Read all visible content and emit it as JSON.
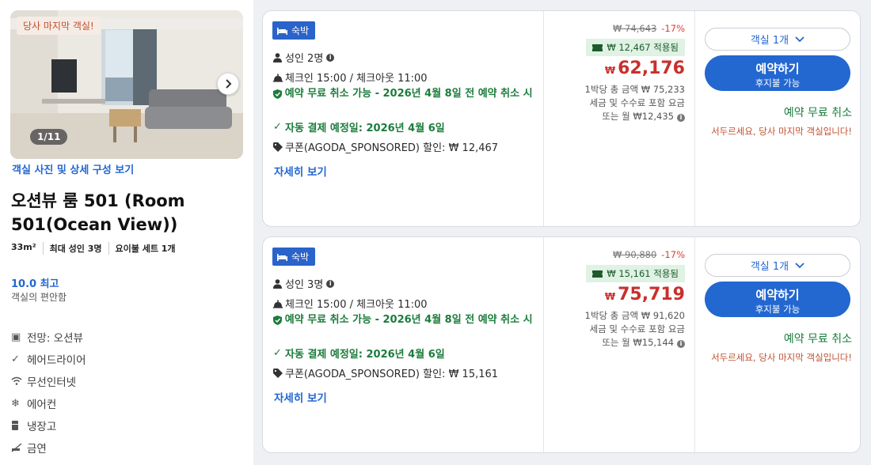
{
  "room": {
    "last_room_badge": "당사 마지막 객실!",
    "photo_counter": "1/11",
    "photo_link": "객실 사진 및 상세 구성 보기",
    "title": "오션뷰 룸 501 (Room 501(Ocean View))",
    "specs": [
      "33m²",
      "최대 성인 3명",
      "요이불 세트 1개"
    ],
    "rating": "10.0 최고",
    "rating_sub": "객실의 편안함",
    "amenities": [
      {
        "icon": "view-icon",
        "label": "전망: 오션뷰"
      },
      {
        "icon": "check-icon",
        "label": "헤어드라이어"
      },
      {
        "icon": "wifi-icon",
        "label": "무선인터넷"
      },
      {
        "icon": "snowflake-icon",
        "label": "에어컨"
      },
      {
        "icon": "fridge-icon",
        "label": "냉장고"
      },
      {
        "icon": "no-smoking-icon",
        "label": "금연"
      }
    ]
  },
  "offers": [
    {
      "tag": "숙박",
      "guests": "성인 2명",
      "checkin": "체크인 15:00 / 체크아웃 11:00",
      "cancel": "예약 무료 취소 가능 - 2026년 4월 8일 전 예약 취소 시",
      "autopay": "자동 결제 예정일: 2026년 4월 6일",
      "coupon": "쿠폰(AGODA_SPONSORED) 할인: ₩ 12,467",
      "details": "자세히 보기",
      "original_price": "₩ 74,643",
      "discount": "-17%",
      "coupon_applied": "₩ 12,467 적용됨",
      "currency": "₩",
      "price": "62,176",
      "per_night": "1박당 총 금액 ₩ 75,233",
      "tax_note": "세금 및 수수료 포함 요금",
      "monthly": "또는 월 ₩12,435",
      "room_select": "객실 1개",
      "book": "예약하기",
      "pay_later": "후지불 가능",
      "free_cancel": "예약 무료 취소",
      "last_room": "서두르세요, 당사 마지막 객실입니다!"
    },
    {
      "tag": "숙박",
      "guests": "성인 3명",
      "checkin": "체크인 15:00 / 체크아웃 11:00",
      "cancel": "예약 무료 취소 가능 - 2026년 4월 8일 전 예약 취소 시",
      "autopay": "자동 결제 예정일: 2026년 4월 6일",
      "coupon": "쿠폰(AGODA_SPONSORED) 할인: ₩ 15,161",
      "details": "자세히 보기",
      "original_price": "₩ 90,880",
      "discount": "-17%",
      "coupon_applied": "₩ 15,161 적용됨",
      "currency": "₩",
      "price": "75,719",
      "per_night": "1박당 총 금액 ₩ 91,620",
      "tax_note": "세금 및 수수료 포함 요금",
      "monthly": "또는 월 ₩15,144",
      "room_select": "객실 1개",
      "book": "예약하기",
      "pay_later": "후지불 가능",
      "free_cancel": "예약 무료 취소",
      "last_room": "서두르세요, 당사 마지막 객실입니다!"
    }
  ]
}
